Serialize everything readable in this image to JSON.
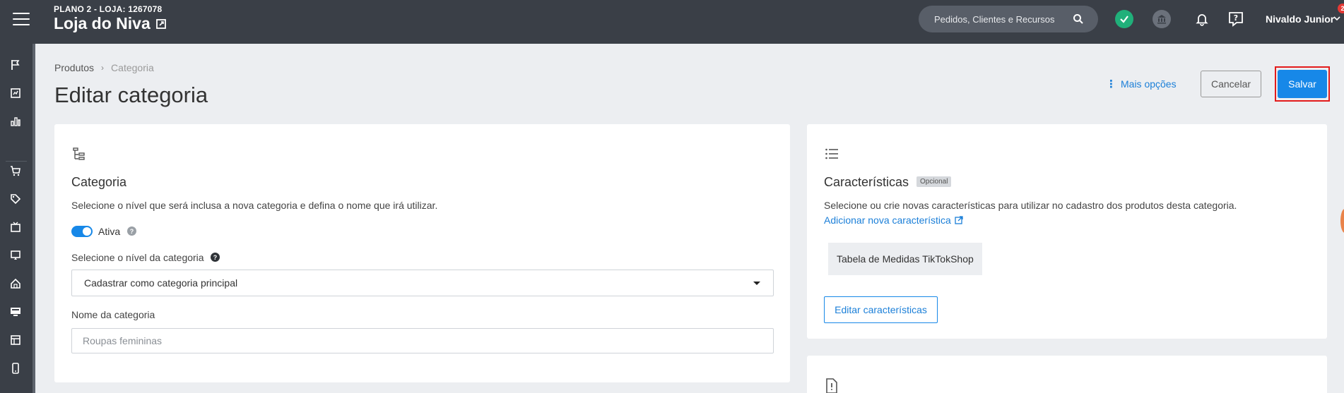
{
  "topbar": {
    "plan": "PLANO 2 - LOJA: 1267078",
    "store_name": "Loja do Niva",
    "search_label": "Pedidos, Clientes e Recursos",
    "user_name": "Nivaldo Junior",
    "notifications": "2"
  },
  "breadcrumb": {
    "root": "Produtos",
    "current": "Categoria"
  },
  "page_title": "Editar categoria",
  "actions": {
    "more": "Mais opções",
    "cancel": "Cancelar",
    "save": "Salvar"
  },
  "category": {
    "title": "Categoria",
    "description": "Selecione o nível que será inclusa a nova categoria e defina o nome que irá utilizar.",
    "toggle_label": "Ativa",
    "level_label": "Selecione o nível da categoria",
    "level_value": "Cadastrar como categoria principal",
    "name_label": "Nome da categoria",
    "name_placeholder": "Roupas femininas"
  },
  "characteristics": {
    "title": "Características",
    "badge": "Opcional",
    "description": "Selecione ou crie novas características para utilizar no cadastro dos produtos desta categoria.",
    "add_link": "Adicionar nova característica",
    "items": [
      "Tabela de Medidas TikTokShop"
    ],
    "edit_button": "Editar características"
  },
  "colors": {
    "topbar": "#3a3f47",
    "primary": "#1788e8",
    "highlight": "#e31b1b",
    "success": "#20b07a"
  }
}
